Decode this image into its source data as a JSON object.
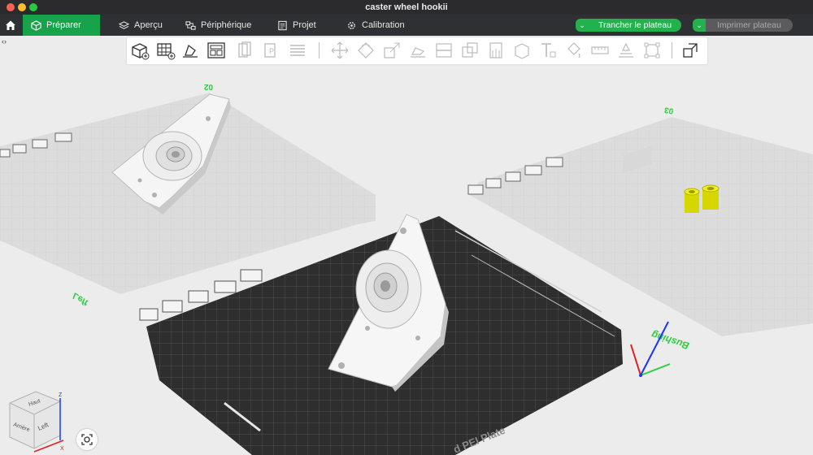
{
  "window": {
    "title": "caster wheel hookii"
  },
  "nav": {
    "tabs": [
      {
        "label": "Préparer",
        "icon": "cube-icon",
        "active": true
      },
      {
        "label": "Aperçu",
        "icon": "layers-icon",
        "active": false
      },
      {
        "label": "Périphérique",
        "icon": "device-icon",
        "active": false
      },
      {
        "label": "Projet",
        "icon": "project-icon",
        "active": false
      },
      {
        "label": "Calibration",
        "icon": "calibration-icon",
        "active": false
      }
    ],
    "slice_label": "Trancher le plateau",
    "print_label": "Imprimer plateau"
  },
  "plates": {
    "left_bottom": "Left",
    "left_top": "02",
    "right_top": "03",
    "front_right": "Bushing",
    "front_text": "d PEI Plate"
  },
  "viewcube": {
    "front": "Arrière",
    "left": "Left",
    "top": "Haut",
    "axis_z": "Z",
    "axis_x": "X"
  },
  "colors": {
    "accent": "#22b14c",
    "nav_bg": "#2f3033",
    "model": "#f2f2f2",
    "bushing": "#e3e300"
  }
}
